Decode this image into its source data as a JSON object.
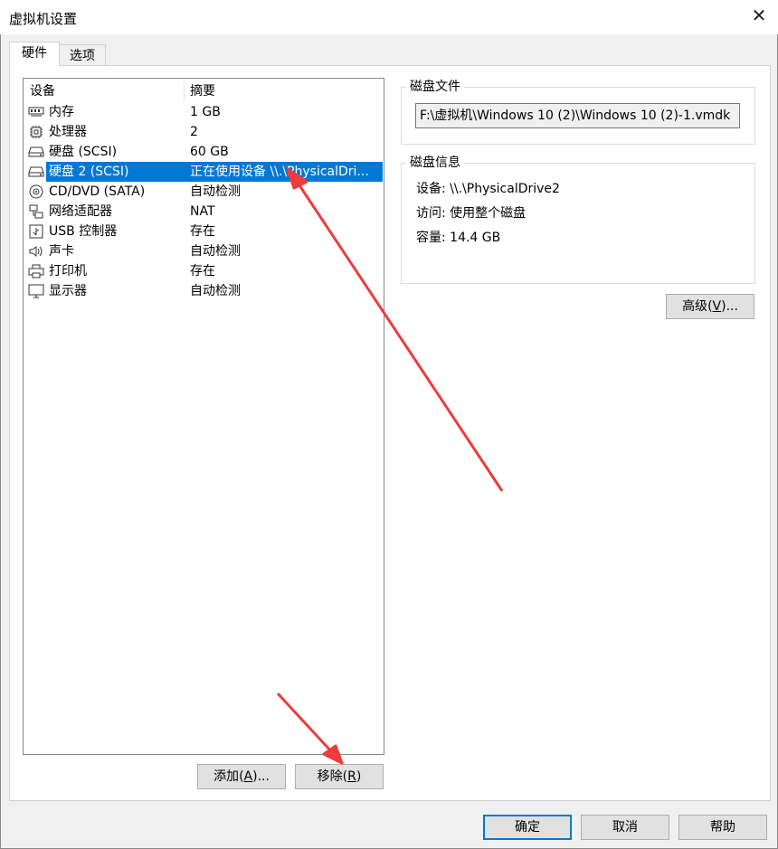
{
  "window": {
    "title": "虚拟机设置",
    "close_glyph": "✕"
  },
  "tabs": [
    {
      "label": "硬件"
    },
    {
      "label": "选项"
    }
  ],
  "device_list": {
    "headers": {
      "device": "设备",
      "summary": "摘要"
    },
    "rows": [
      {
        "name": "内存",
        "summary": "1 GB",
        "icon": "memory-icon"
      },
      {
        "name": "处理器",
        "summary": "2",
        "icon": "processor-icon"
      },
      {
        "name": "硬盘 (SCSI)",
        "summary": "60 GB",
        "icon": "harddisk-icon"
      },
      {
        "name": "硬盘 2 (SCSI)",
        "summary": "正在使用设备 \\\\.\\PhysicalDri...",
        "icon": "harddisk-icon",
        "selected": true
      },
      {
        "name": "CD/DVD (SATA)",
        "summary": "自动检测",
        "icon": "cdrom-icon"
      },
      {
        "name": "网络适配器",
        "summary": "NAT",
        "icon": "network-icon"
      },
      {
        "name": "USB 控制器",
        "summary": "存在",
        "icon": "usb-icon"
      },
      {
        "name": "声卡",
        "summary": "自动检测",
        "icon": "speaker-icon"
      },
      {
        "name": "打印机",
        "summary": "存在",
        "icon": "printer-icon"
      },
      {
        "name": "显示器",
        "summary": "自动检测",
        "icon": "monitor-icon"
      }
    ]
  },
  "list_buttons": {
    "add": {
      "label": "添加",
      "accel": "A",
      "suffix": "..."
    },
    "remove": {
      "label": "移除",
      "accel": "R",
      "suffix": ""
    }
  },
  "disk_file": {
    "group_title": "磁盘文件",
    "path": "F:\\虚拟机\\Windows 10 (2)\\Windows 10 (2)-1.vmdk"
  },
  "disk_info": {
    "group_title": "磁盘信息",
    "device": "设备: \\\\.\\PhysicalDrive2",
    "access": "访问: 使用整个磁盘",
    "capacity": "容量: 14.4 GB"
  },
  "advanced_button": {
    "label": "高级",
    "accel": "V",
    "suffix": "..."
  },
  "footer": {
    "ok": "确定",
    "cancel": "取消",
    "help": "帮助"
  },
  "annotation_color": "#ee3b3b"
}
